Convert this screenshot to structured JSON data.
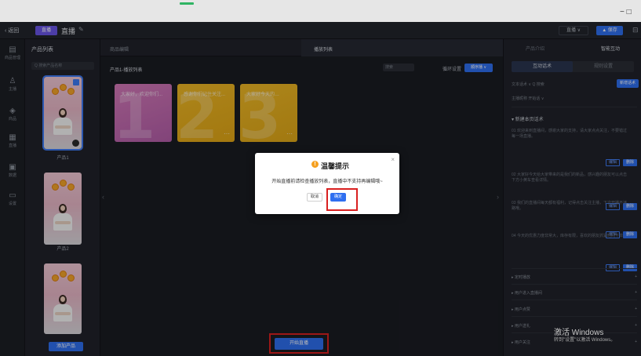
{
  "titlebar": {
    "controls": "− □"
  },
  "toolbar": {
    "back": "‹ 返回",
    "badge": "直播",
    "title": "直播",
    "edit_icon": "✎",
    "btn1": "直播 ∨",
    "btn2": "▲ 保存",
    "icon": "⊟"
  },
  "rail": [
    {
      "icon": "▤",
      "label": "商品管理"
    },
    {
      "icon": "♙",
      "label": "主播"
    },
    {
      "icon": "◈",
      "label": "商品"
    },
    {
      "icon": "▦",
      "label": "直播"
    },
    {
      "icon": "▣",
      "label": "数据"
    },
    {
      "icon": "▭",
      "label": "设置"
    }
  ],
  "products": {
    "title": "产品列表",
    "search_placeholder": "Q 搜索产品名称",
    "items": [
      {
        "name": "产品1"
      },
      {
        "name": "产品2"
      },
      {
        "name": ""
      }
    ],
    "add_label": "添加产品"
  },
  "center": {
    "tab1": "商品编辑",
    "tab2": "播放列表",
    "subtitle": "产品1-播放列表",
    "dropdown1": "搜索",
    "loop_label": "循环设置",
    "dropdown2": "顺序播 ∨",
    "scripts": [
      {
        "title": "大家好，欢迎你们...",
        "num": "1",
        "color": "#b45ea9",
        "color2": "#d57ab9"
      },
      {
        "title": "感谢你们记住关注...",
        "num": "2",
        "color": "#e2a716",
        "color2": "#f0b926"
      },
      {
        "title": "大家好今天的…",
        "num": "3",
        "color": "#e0a818",
        "color2": "#f0b926"
      }
    ],
    "start_label": "开始直播",
    "arrow_left": "‹",
    "arrow_right": "›"
  },
  "modal": {
    "title": "温馨提示",
    "warn_icon": "!",
    "message": "开始直播前请检查播放列表，直播中不支持再编辑哦~",
    "cancel": "取消",
    "ok": "确定",
    "close": "×"
  },
  "right": {
    "tab1": "产品介绍",
    "tab2": "智能互动",
    "seg_on": "互动话术",
    "seg_off": "规则设置",
    "row1": "文本话术 ∨    Q 搜索",
    "row2": "主播昵称    开始话 ∨",
    "new_label": "新增话术",
    "section": "▾ 新建本页话术",
    "items": [
      {
        "text": "01 欢迎来到直播间，感谢大家的支持，请大家点点关注，不要错过每一场直播。",
        "b1": "编辑",
        "b2": "删除"
      },
      {
        "text": "02 大家好今天给大家带来的是我们的新品，感兴趣的朋友可以点击下方小黄车查看详情。",
        "b1": "编辑",
        "b2": "删除"
      },
      {
        "text": "03 我们的直播间每天都有福利，记得点击关注主播，下次开播不迷路哦。",
        "b1": "编辑",
        "b2": "删除"
      },
      {
        "text": "04 今天的优惠力度非常大，库存有限，喜欢的朋友抓紧时间下单。",
        "b1": "编辑",
        "b2": "删除"
      }
    ],
    "collapsed": [
      "▸ 定时播放",
      "▸ 用户进入直播间",
      "▸ 用户点赞",
      "▸ 用户送礼",
      "▸ 用户关注"
    ],
    "plus": "+"
  },
  "watermark": {
    "line1": "激活 Windows",
    "line2": "转到\"设置\"以激活 Windows。"
  }
}
